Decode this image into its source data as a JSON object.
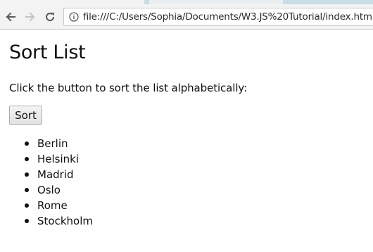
{
  "browser": {
    "back_icon": "arrow-left-icon",
    "forward_icon": "arrow-right-icon",
    "reload_icon": "reload-icon",
    "info_icon": "info-icon",
    "url": "file:///C:/Users/Sophia/Documents/W3.JS%20Tutorial/index.html"
  },
  "page": {
    "title": "Sort List",
    "instruction": "Click the button to sort the list alphabetically:",
    "button_label": "Sort",
    "cities": [
      "Berlin",
      "Helsinki",
      "Madrid",
      "Oslo",
      "Rome",
      "Stockholm"
    ]
  },
  "colors": {
    "toolbar": "#f3f3f3",
    "tabstrip": "#c9dde6",
    "text": "#111111"
  }
}
